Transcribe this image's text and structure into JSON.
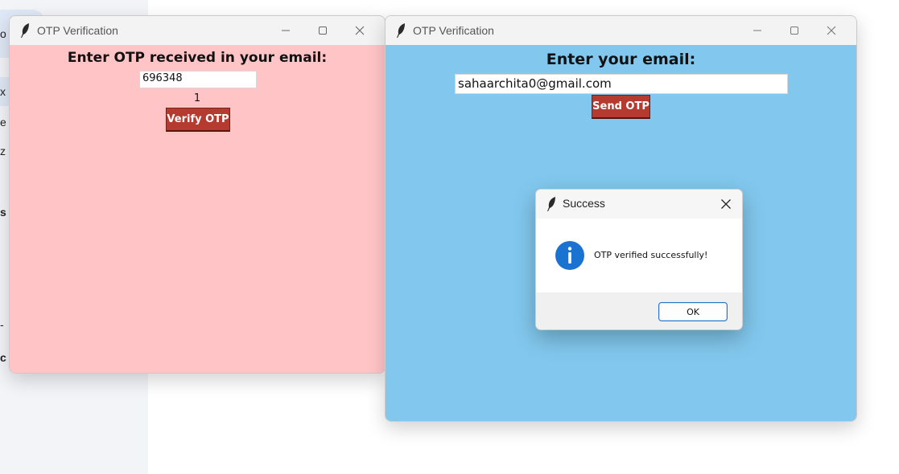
{
  "background_app": {
    "fragments": [
      "o",
      "x",
      "e",
      "z",
      "s",
      "-",
      "c"
    ]
  },
  "left_window": {
    "title": "OTP Verification",
    "icon": "feather-icon",
    "prompt_label": "Enter OTP received in your email:",
    "otp_value": "696348",
    "counter": "1",
    "verify_button": "Verify OTP",
    "background_color": "#ffc4c6"
  },
  "right_window": {
    "title": "OTP Verification",
    "icon": "feather-icon",
    "prompt_label": "Enter your email:",
    "email_value": "sahaarchita0@gmail.com",
    "send_button": "Send OTP",
    "background_color": "#82c8ee"
  },
  "dialog": {
    "title": "Success",
    "icon": "info-icon",
    "message": "OTP verified successfully!",
    "ok_button": "OK"
  },
  "colors": {
    "button_red": "#b53a2f",
    "info_blue": "#1a73d0"
  }
}
